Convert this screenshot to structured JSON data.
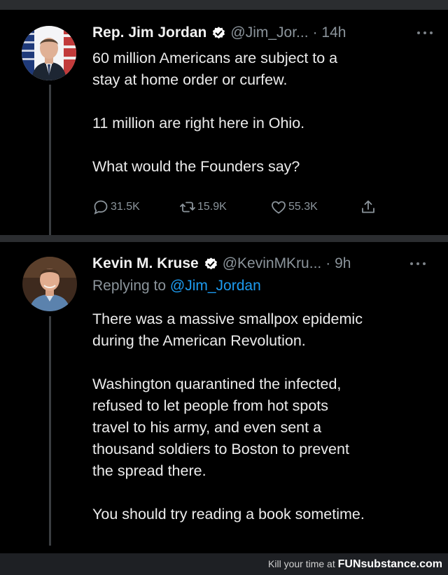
{
  "tweets": [
    {
      "name": "Rep. Jim Jordan",
      "handle": "@Jim_Jor...",
      "time": "· 14h",
      "lines": [
        "60 million Americans are subject to a",
        "stay at home order or curfew.",
        "",
        "11 million are right here in Ohio.",
        "",
        "What would the Founders say?"
      ],
      "actions": {
        "replies": "31.5K",
        "retweets": "15.9K",
        "likes": "55.3K"
      }
    },
    {
      "name": "Kevin M. Kruse",
      "handle": "@KevinMKru...",
      "time": "· 9h",
      "replying_prefix": "Replying to",
      "replying_to": "@Jim_Jordan",
      "lines": [
        "There was a massive smallpox epidemic",
        "during the American Revolution.",
        "",
        "Washington quarantined the infected,",
        "refused to let people from hot spots",
        "travel to his army, and even sent a",
        "thousand soldiers to Boston to prevent",
        "the spread there.",
        "",
        "You should try reading a book sometime."
      ]
    }
  ],
  "footer": {
    "prefix": "Kill your time at",
    "site": "FUNsubstance.com"
  },
  "colors": {
    "background": "#000000",
    "text": "#e7e9ea",
    "muted": "#8b949b",
    "link": "#1d9bf0",
    "verified": "#ffffff"
  },
  "icons": [
    "verified-badge-icon",
    "more-icon",
    "reply-icon",
    "retweet-icon",
    "like-icon",
    "share-icon"
  ]
}
